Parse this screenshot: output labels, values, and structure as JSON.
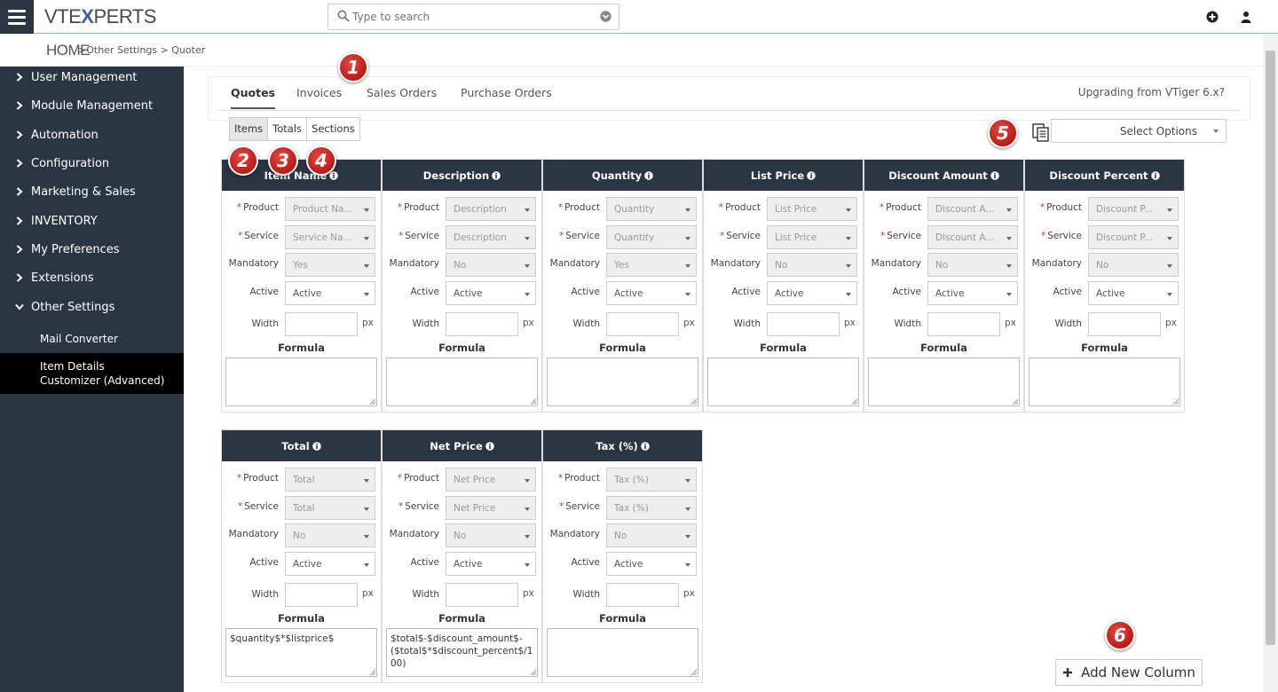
{
  "app": {
    "logo_pre": "VTE",
    "logo_x": "X",
    "logo_post": "PERTS",
    "search_placeholder": "Type to search"
  },
  "breadcrumb": {
    "home": "HOME",
    "rest": ">Other Settings > Quoter"
  },
  "sidebar": {
    "items": [
      {
        "label": "User Management"
      },
      {
        "label": "Module Management"
      },
      {
        "label": "Automation"
      },
      {
        "label": "Configuration"
      },
      {
        "label": "Marketing & Sales"
      },
      {
        "label": "INVENTORY"
      },
      {
        "label": "My Preferences"
      },
      {
        "label": "Extensions"
      },
      {
        "label": "Other Settings"
      }
    ],
    "subitems": [
      {
        "label": "Mail Converter"
      },
      {
        "label": "Item Details Customizer (Advanced)"
      }
    ]
  },
  "tabs": [
    {
      "label": "Quotes"
    },
    {
      "label": "Invoices"
    },
    {
      "label": "Sales Orders"
    },
    {
      "label": "Purchase Orders"
    }
  ],
  "upgrade_link": "Upgrading from VTiger 6.x?",
  "subtabs": [
    {
      "label": "Items"
    },
    {
      "label": "Totals"
    },
    {
      "label": "Sections"
    }
  ],
  "select_options": "Select Options",
  "field_labels": {
    "product": "Product",
    "service": "Service",
    "mandatory": "Mandatory",
    "active": "Active",
    "width": "Width",
    "px": "px",
    "formula": "Formula",
    "required_mark": "*"
  },
  "columns": [
    {
      "title": "Item Name",
      "product": "Product Na...",
      "service": "Service Na...",
      "mandatory": "Yes",
      "active": "Active",
      "formula": ""
    },
    {
      "title": "Description",
      "product": "Description",
      "service": "Description",
      "mandatory": "No",
      "active": "Active",
      "formula": ""
    },
    {
      "title": "Quantity",
      "product": "Quantity",
      "service": "Quantity",
      "mandatory": "Yes",
      "active": "Active",
      "formula": ""
    },
    {
      "title": "List Price",
      "product": "List Price",
      "service": "List Price",
      "mandatory": "No",
      "active": "Active",
      "formula": ""
    },
    {
      "title": "Discount Amount",
      "product": "Discount A...",
      "service": "Discount A...",
      "mandatory": "No",
      "active": "Active",
      "formula": ""
    },
    {
      "title": "Discount Percent",
      "product": "Discount P...",
      "service": "Discount P...",
      "mandatory": "No",
      "active": "Active",
      "formula": ""
    },
    {
      "title": "Total",
      "product": "Total",
      "service": "Total",
      "mandatory": "No",
      "active": "Active",
      "formula": "$quantity$*$listprice$"
    },
    {
      "title": "Net Price",
      "product": "Net Price",
      "service": "Net Price",
      "mandatory": "No",
      "active": "Active",
      "formula": "$total$-$discount_amount$-($total$*$discount_percent$/100)"
    },
    {
      "title": "Tax (%)",
      "product": "Tax (%)",
      "service": "Tax (%)",
      "mandatory": "No",
      "active": "Active",
      "formula": ""
    }
  ],
  "markers": [
    "1",
    "2",
    "3",
    "4",
    "5",
    "6"
  ],
  "add_column_label": "Add New Column",
  "colors": {
    "sidebar_bg": "#2b3643",
    "header_bg": "#2b3643",
    "accent_border": "#e8a164",
    "marker_red": "#c62a22"
  }
}
